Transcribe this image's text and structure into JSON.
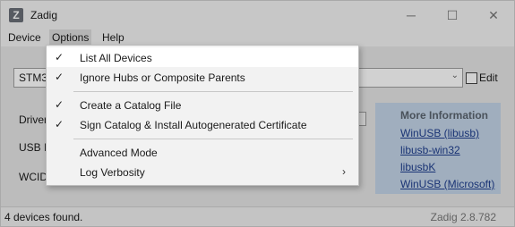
{
  "window": {
    "title": "Zadig",
    "minimize": "─",
    "maximize": "☐",
    "close": "✕"
  },
  "menubar": [
    "Device",
    "Options",
    "Help"
  ],
  "device_combo": {
    "value": "STM3"
  },
  "edit": {
    "label": "Edit"
  },
  "fields": [
    "Driver",
    "USB II",
    "WCID"
  ],
  "more_info": {
    "title": "More Information",
    "links": [
      "WinUSB (libusb)",
      "libusb-win32",
      "libusbK",
      "WinUSB (Microsoft)"
    ]
  },
  "status": {
    "left": "4 devices found.",
    "right": "Zadig 2.8.782"
  },
  "options_menu": [
    {
      "label": "List All Devices",
      "checked": true,
      "highlighted": true
    },
    {
      "label": "Ignore Hubs or Composite Parents",
      "checked": true
    },
    {
      "label": "Create a Catalog File",
      "checked": true
    },
    {
      "label": "Sign Catalog & Install Autogenerated Certificate",
      "checked": true
    },
    {
      "label": "Advanced Mode",
      "checked": false
    },
    {
      "label": "Log Verbosity",
      "checked": false,
      "submenu": true
    }
  ],
  "glyphs": {
    "check": "✓",
    "submenu_arrow": "›",
    "dropdown_arrow": "⌄",
    "app_icon": "Z"
  }
}
